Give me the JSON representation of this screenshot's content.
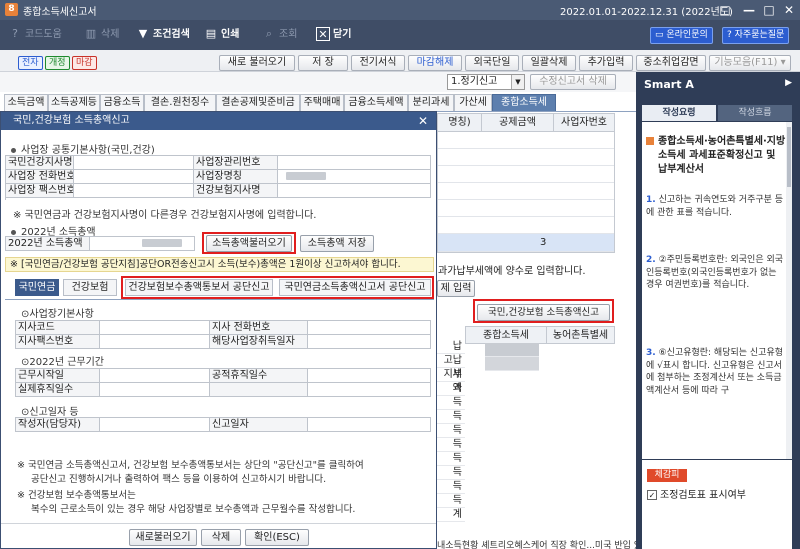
{
  "window": {
    "app_icon": "8",
    "title": "종합소득세신고서",
    "period": "2022.01.01-2022.12.31 (2022년도)",
    "controls": [
      "□",
      "—",
      "□",
      "✕"
    ]
  },
  "toolbar": {
    "help": "코드도움",
    "delete": "삭제",
    "filter": "조건검색",
    "print": "인쇄",
    "search": "조회",
    "close": "닫기",
    "online": "온라인문의",
    "faq": "자주묻는질문"
  },
  "action_bar": {
    "badges": [
      "전자",
      "개정",
      "마감"
    ],
    "buttons": [
      "새로 불러오기",
      "저 장",
      "전기서식",
      "마감해제",
      "외국단일",
      "일괄삭제",
      "추가입력",
      "중소취업감면",
      "기능모음(F11) ▾"
    ]
  },
  "filing": {
    "type_selected": "1.정기신고",
    "amend_delete": "수정신고서 삭제"
  },
  "tabs": [
    "소득금액",
    "소득공제등",
    "금융소득",
    "결손.원천징수",
    "결손공제및준비금",
    "주택매매",
    "금융소득세액",
    "분리과세",
    "가산세",
    "종합소득세"
  ],
  "background": {
    "grid_headers": [
      "명칭)",
      "공제금액",
      "사업자번호"
    ],
    "grid_total": "3",
    "side_note": "과가납부세액에 양수로 입력합니다.",
    "deduct_input": "제 입력",
    "national_report_button": "국민,건강보험 소득총액신고",
    "col_headers": [
      "종합소득세",
      "농어촌특별세"
    ],
    "row_labels": [
      "납",
      "고납부",
      "지세액",
      "과",
      "득",
      "득",
      "득",
      "득",
      "득",
      "득",
      "득",
      "득",
      "계"
    ],
    "bottom_strip": "내소득현황  셰트리오혜스케어 직장 확인...미국 반입 있스"
  },
  "smart": {
    "header": "Smart A",
    "tab_active": "작성요령",
    "tab_inactive": "작성흐름",
    "heading": "종합소득세·농어촌특별세·지방소득세 과세표준확정신고 및 납부계산서",
    "items": [
      {
        "num": "1.",
        "text": "신고하는 귀속연도와 거주구분 등에 관한 표를 적습니다."
      },
      {
        "num": "2.",
        "text": "②주민등록번호란: 외국인은 외국인등록번호(외국인등록번호가 없는 경우 여권번호)를 적습니다."
      },
      {
        "num": "3.",
        "text": "⑥신고유형란: 해당되는 신고유형에 √표시 합니다. 신고유형은 신고서에 첨부하는 조정계산서 또는 소득금액계산서 등에 따라 구"
      }
    ],
    "bottom_tab": "체감피",
    "checkbox_label": "조정검토표 표시여부",
    "checkbox_checked": "✓"
  },
  "dialog": {
    "title": "국민,건강보험 소득총액신고",
    "close": "✕",
    "sec1": "사업장 공통기본사항(국민,건강)",
    "sec1_rows": [
      [
        "국민건강지사명",
        "",
        "사업장관리번호",
        ""
      ],
      [
        "사업장 전화번호",
        "",
        "사업장명칭",
        ""
      ],
      [
        "사업장 팩스번호",
        "",
        "건강보험지사명",
        ""
      ]
    ],
    "note1": "※ 국민연금과 건강보험지사명이 다른경우 건강보험지사명에 입력합니다.",
    "sec2": "2022년 소득총액",
    "income_label": "2022년 소득총액",
    "load_income": "소득총액불러오기",
    "save_income": "소득총액 저장",
    "notice": "※ [국민연금/건강보험 공단지침]공단OR전송신고시 소득(보수)총액은 1원이상 신고하셔야 합니다.",
    "tabs": [
      "국민연금",
      "건강보험",
      "건강보험보수총액통보서 공단신고",
      "국민연금소득총액신고서 공단신고"
    ],
    "ssec1": "⊙사업장기본사항",
    "grid1": [
      [
        "지사코드",
        "",
        "지사 전화번호",
        ""
      ],
      [
        "지사팩스번호",
        "",
        "해당사업장취득일자",
        ""
      ]
    ],
    "ssec2": "⊙2022년 근무기간",
    "grid2": [
      [
        "근무시작일",
        "",
        "공적휴직일수",
        ""
      ],
      [
        "실제휴직일수",
        "",
        "",
        ""
      ]
    ],
    "ssec3": "⊙신고일자 등",
    "grid3": [
      [
        "작성자(담당자)",
        "",
        "신고일자",
        ""
      ]
    ],
    "note2a": "※  국민연금 소득총액신고서, 건강보험 보수총액통보서는 상단의 \"공단신고\"를 클릭하여",
    "note2b": "공단신고 진행하시거나 출력하여 팩스 등을 이용하여 신고하시기 바랍니다.",
    "note3a": "※  건강보험 보수총액통보서는",
    "note3b": "복수의 근로소득이 있는 경우 해당 사업장별로 보수총액과 근무월수를 작성합니다.",
    "footer": [
      "새로불러오기",
      "삭제",
      "확인(ESC)"
    ]
  },
  "colors": {
    "titlebar": "#4a5a74",
    "toolbar": "#3f4d66",
    "dialog_header": "#3b5a8c",
    "highlight_red": "#e01e1e",
    "smart_bg": "#2f3d57"
  }
}
